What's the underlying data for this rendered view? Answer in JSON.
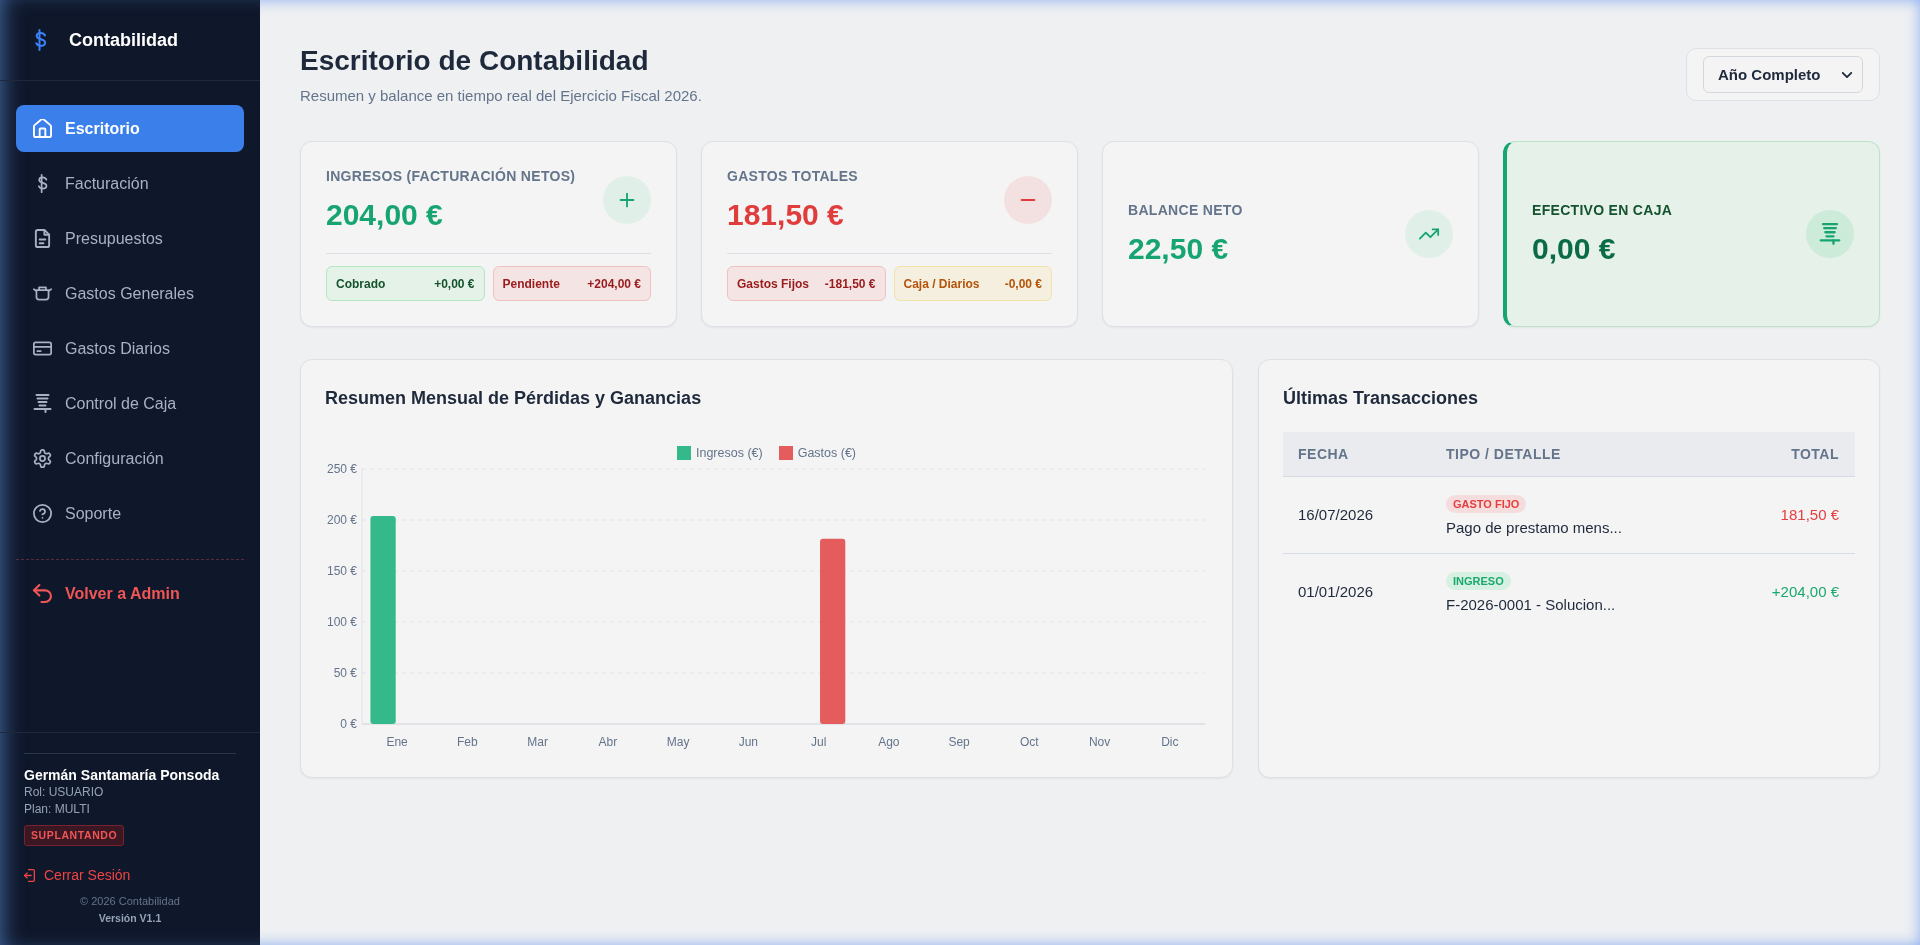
{
  "sidebar": {
    "brand": "Contabilidad",
    "nav": [
      {
        "label": "Escritorio",
        "selected": true
      },
      {
        "label": "Facturación",
        "selected": false
      },
      {
        "label": "Presupuestos",
        "selected": false
      },
      {
        "label": "Gastos Generales",
        "selected": false
      },
      {
        "label": "Gastos Diarios",
        "selected": false
      },
      {
        "label": "Control de Caja",
        "selected": false
      },
      {
        "label": "Configuración",
        "selected": false
      },
      {
        "label": "Soporte",
        "selected": false
      }
    ],
    "admin_link": "Volver a Admin",
    "user": {
      "name": "Germán Santamaría Ponsoda",
      "role": "Rol: USUARIO",
      "plan": "Plan: MULTI",
      "badge": "SUPLANTANDO"
    },
    "logout": "Cerrar Sesión",
    "copyright": "© 2026 Contabilidad",
    "version": "Versión V1.1"
  },
  "header": {
    "title": "Escritorio de Contabilidad",
    "subtitle": "Resumen y balance en tiempo real del Ejercicio Fiscal 2026.",
    "period_select": {
      "value": "Año Completo"
    }
  },
  "kpis": [
    {
      "kind": "income",
      "label": "INGRESOS (FACTURACIÓN NETOS)",
      "value": "204,00 €",
      "breakdown": [
        {
          "kind": "success",
          "label": "Cobrado",
          "value": "+0,00 €"
        },
        {
          "kind": "danger",
          "label": "Pendiente",
          "value": "+204,00 €"
        }
      ]
    },
    {
      "kind": "expense",
      "label": "GASTOS TOTALES",
      "value": "181,50 €",
      "breakdown": [
        {
          "kind": "danger",
          "label": "Gastos Fijos",
          "value": "-181,50 €"
        },
        {
          "kind": "warning",
          "label": "Caja / Diarios",
          "value": "-0,00 €"
        }
      ]
    },
    {
      "kind": "balance",
      "label": "BALANCE NETO",
      "value": "22,50 €"
    },
    {
      "kind": "cash",
      "label": "EFECTIVO EN CAJA",
      "value": "0,00 €"
    }
  ],
  "monthly_chart": {
    "title": "Resumen Mensual de Pérdidas y Ganancias",
    "chart_data": {
      "type": "bar",
      "categories": [
        "Ene",
        "Feb",
        "Mar",
        "Abr",
        "May",
        "Jun",
        "Jul",
        "Ago",
        "Sep",
        "Oct",
        "Nov",
        "Dic"
      ],
      "series": [
        {
          "name": "Ingresos (€)",
          "color": "#34b98a",
          "values": [
            204,
            0,
            0,
            0,
            0,
            0,
            0,
            0,
            0,
            0,
            0,
            0
          ]
        },
        {
          "name": "Gastos (€)",
          "color": "#e55c5c",
          "values": [
            0,
            0,
            0,
            0,
            0,
            0,
            181.5,
            0,
            0,
            0,
            0,
            0
          ]
        }
      ],
      "ylim": [
        0,
        250
      ],
      "yticks": [
        {
          "value": 0,
          "label": "0 €"
        },
        {
          "value": 50,
          "label": "50 €"
        },
        {
          "value": 100,
          "label": "100 €"
        },
        {
          "value": 150,
          "label": "150 €"
        },
        {
          "value": 200,
          "label": "200 €"
        },
        {
          "value": 250,
          "label": "250 €"
        }
      ],
      "grid": true,
      "legend": "top"
    }
  },
  "transactions": {
    "title": "Últimas Transacciones",
    "columns": [
      "FECHA",
      "TIPO / DETALLE",
      "TOTAL"
    ],
    "rows": [
      {
        "date": "16/07/2026",
        "kind": "expense",
        "tag": "GASTO FIJO",
        "detail": "Pago de prestamo mens...",
        "total": "181,50 €"
      },
      {
        "date": "01/01/2026",
        "kind": "income",
        "tag": "INGRESO",
        "detail": "F-2026-0001 - Solucion...",
        "total": "+204,00 €"
      }
    ]
  }
}
